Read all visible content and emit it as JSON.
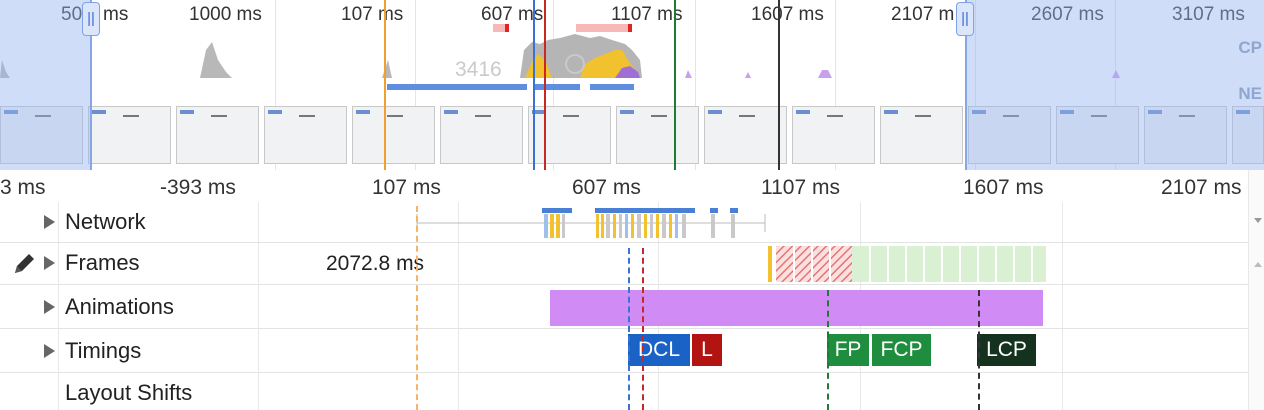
{
  "overview": {
    "ticks": [
      "50",
      "ms",
      "1000 ms",
      "107 ms",
      "607 ms",
      "1107 ms",
      "1607 ms",
      "2107 m",
      "2607 ms",
      "3107 ms"
    ],
    "lanes": {
      "cpu": "CP",
      "net": "NE"
    },
    "ghost_text": "3416"
  },
  "ruler": {
    "ticks": [
      "3 ms",
      "-393 ms",
      "107 ms",
      "607 ms",
      "1107 ms",
      "1607 ms",
      "2107 ms"
    ]
  },
  "tracks": {
    "network": "Network",
    "frames": "Frames",
    "frames_duration": "2072.8 ms",
    "animations": "Animations",
    "timings": "Timings",
    "layout_shifts": "Layout Shifts"
  },
  "markers": {
    "dcl": "DCL",
    "l": "L",
    "fp": "FP",
    "fcp": "FCP",
    "lcp": "LCP"
  },
  "colors": {
    "dcl": "#1a62c6",
    "l": "#b31412",
    "fp": "#1e8e3e",
    "fcp": "#1e8e3e",
    "lcp": "#14321e",
    "animation": "#d08bf5",
    "selection": "#a0bcf2"
  },
  "icons": {
    "edit": "pencil-icon",
    "expand": "triangle-right-icon",
    "handle": "drag-handle-icon"
  }
}
